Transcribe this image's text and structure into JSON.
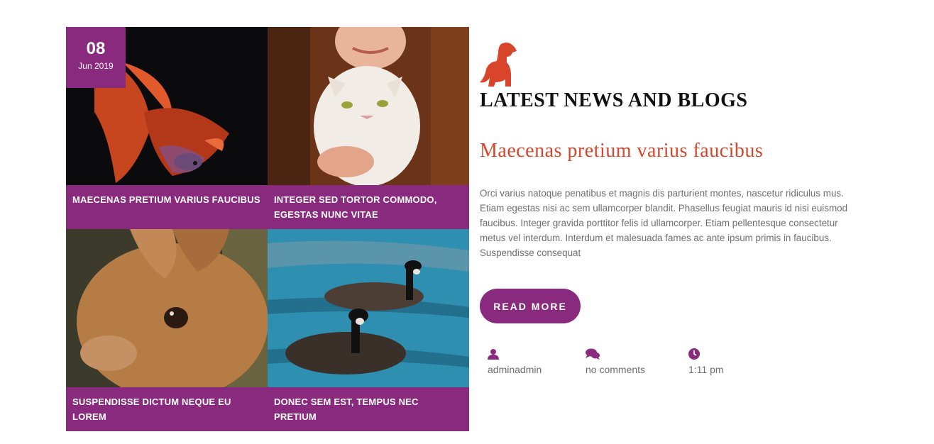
{
  "date": {
    "day": "08",
    "month": "Jun 2019"
  },
  "cards": [
    {
      "title": "MAECENAS PRETIUM VARIUS FAUCIBUS",
      "image": "betta-fish-photo"
    },
    {
      "title": "INTEGER SED TORTOR COMMODO, EGESTAS NUNC VITAE",
      "image": "girl-holding-cat-photo"
    },
    {
      "title": "SUSPENDISSE DICTUM NEQUE EU LOREM",
      "image": "rabbit-photo"
    },
    {
      "title": "DONEC SEM EST, TEMPUS NEC PRETIUM",
      "image": "geese-on-water-photo"
    }
  ],
  "section": {
    "heading": "LATEST NEWS AND BLOGS",
    "icon": "dog-icon"
  },
  "post": {
    "title": "Maecenas pretium varius faucibus",
    "body": "Orci varius natoque penatibus et magnis dis parturient montes, nascetur ridiculus mus. Etiam egestas nisi ac sem ullamcorper blandit. Phasellus feugiat mauris id nisi euismod faucibus. Integer gravida porttitor felis id ullamcorper. Etiam pellentesque consectetur metus vel interdum. Interdum et malesuada fames ac ante ipsum primis in faucibus. Suspendisse consequat",
    "read_more": "READ MORE"
  },
  "meta": {
    "author": "adminadmin",
    "comments": "no comments",
    "time": "1:11 pm"
  },
  "colors": {
    "accent": "#8a2a7e",
    "title": "#d8452b"
  }
}
